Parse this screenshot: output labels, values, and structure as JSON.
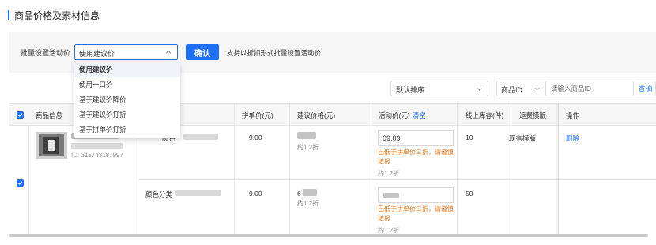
{
  "section": {
    "title": "商品价格及素材信息"
  },
  "batch": {
    "label": "批量设置活动价",
    "select_value": "使用建议价",
    "confirm_label": "确认",
    "hint": "支持以折扣形式批量设置活动价",
    "dropdown_options": [
      "使用建议价",
      "使用一口价",
      "基于建议价降价",
      "基于建议价打折",
      "基于拼单价打折"
    ]
  },
  "toolbar": {
    "sort_value": "默认排序",
    "search_type": "商品ID",
    "search_placeholder": "请输入商品ID",
    "search_button": "查询"
  },
  "table": {
    "headers": {
      "goods": "商品信息",
      "group_price": "拼单价(元)",
      "suggested_price": "建议价格(元)",
      "activity_price": "活动价(元)",
      "clear": "清空",
      "stock": "线上库存(件)",
      "freight": "运费模版",
      "ops": "操作"
    },
    "product": {
      "id_text": "ID: 315743187997"
    },
    "rows": [
      {
        "sku_label": "颜色",
        "group_price": "9.00",
        "suggested_discount": "约1.2折",
        "activity_value": "09.09",
        "warning": "已低于拼单价三折，请谨慎填报",
        "activity_discount": "约1.2折",
        "stock": "10",
        "freight": "现有模版",
        "op": "删除"
      },
      {
        "sku_label": "颜色分类",
        "group_price": "9.00",
        "suggested_prefix": "6",
        "suggested_discount": "约1.2折",
        "activity_value": "",
        "warning": "已低于拼单价三折，请谨慎填报",
        "activity_discount": "约1.2折",
        "stock": "50",
        "freight": "",
        "op": ""
      }
    ]
  },
  "colors": {
    "accent": "#1f6ff5",
    "warning": "#f07a1f"
  },
  "icons": [
    "chevron-up-icon",
    "chevron-down-icon",
    "checkbox-checked-icon"
  ]
}
